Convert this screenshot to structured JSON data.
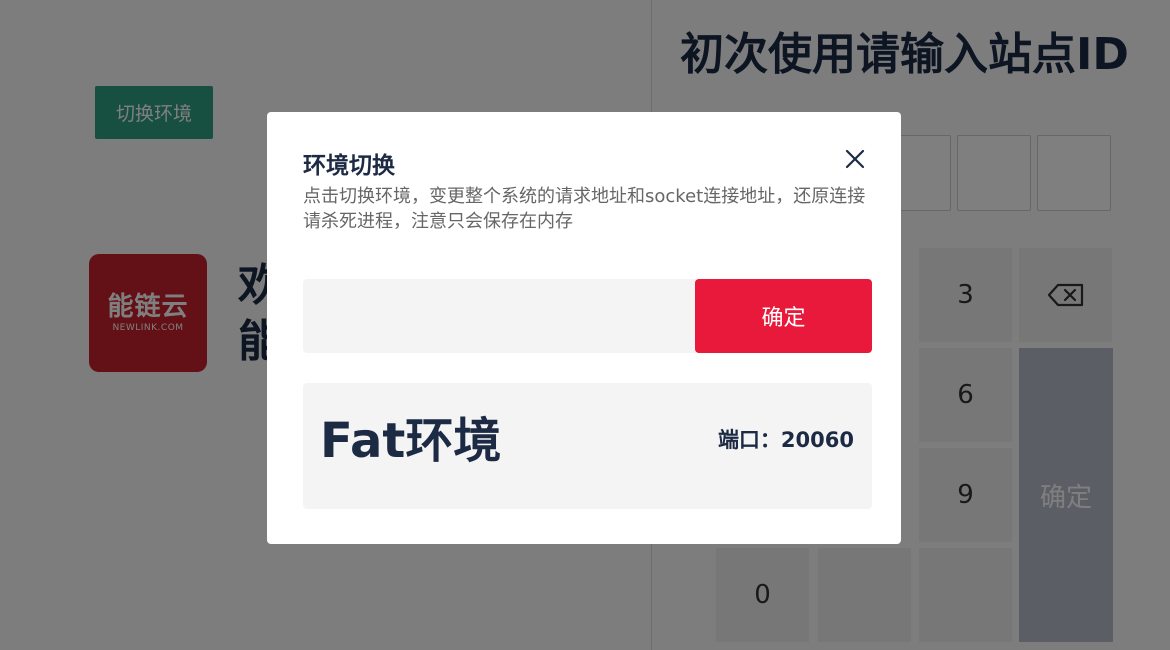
{
  "left": {
    "env_button": "切换环境",
    "logo": {
      "cn": "能链云",
      "en": "NEWLINK.COM",
      "color": "#c8202f"
    },
    "welcome_line1": "欢",
    "welcome_line2": "能"
  },
  "right": {
    "title": "初次使用请输入站点ID",
    "keypad": {
      "k3": "3",
      "k6": "6",
      "k9": "9",
      "k0": "0",
      "backspace_icon": "backspace-icon",
      "confirm": "确定"
    }
  },
  "modal": {
    "title": "环境切换",
    "close_icon": "close-icon",
    "description": "点击切换环境，变更整个系统的请求地址和socket连接地址，还原连接请杀死进程，注意只会保存在内存",
    "input_value": "",
    "input_placeholder": "",
    "confirm": "确定",
    "env_card": {
      "name": "Fat环境",
      "port": "端口：20060"
    }
  },
  "colors": {
    "accent_red": "#e8193a",
    "env_button_green": "#2e9e80",
    "text_dark": "#1c2a44",
    "keypad_confirm_disabled": "#b7bdcb"
  }
}
